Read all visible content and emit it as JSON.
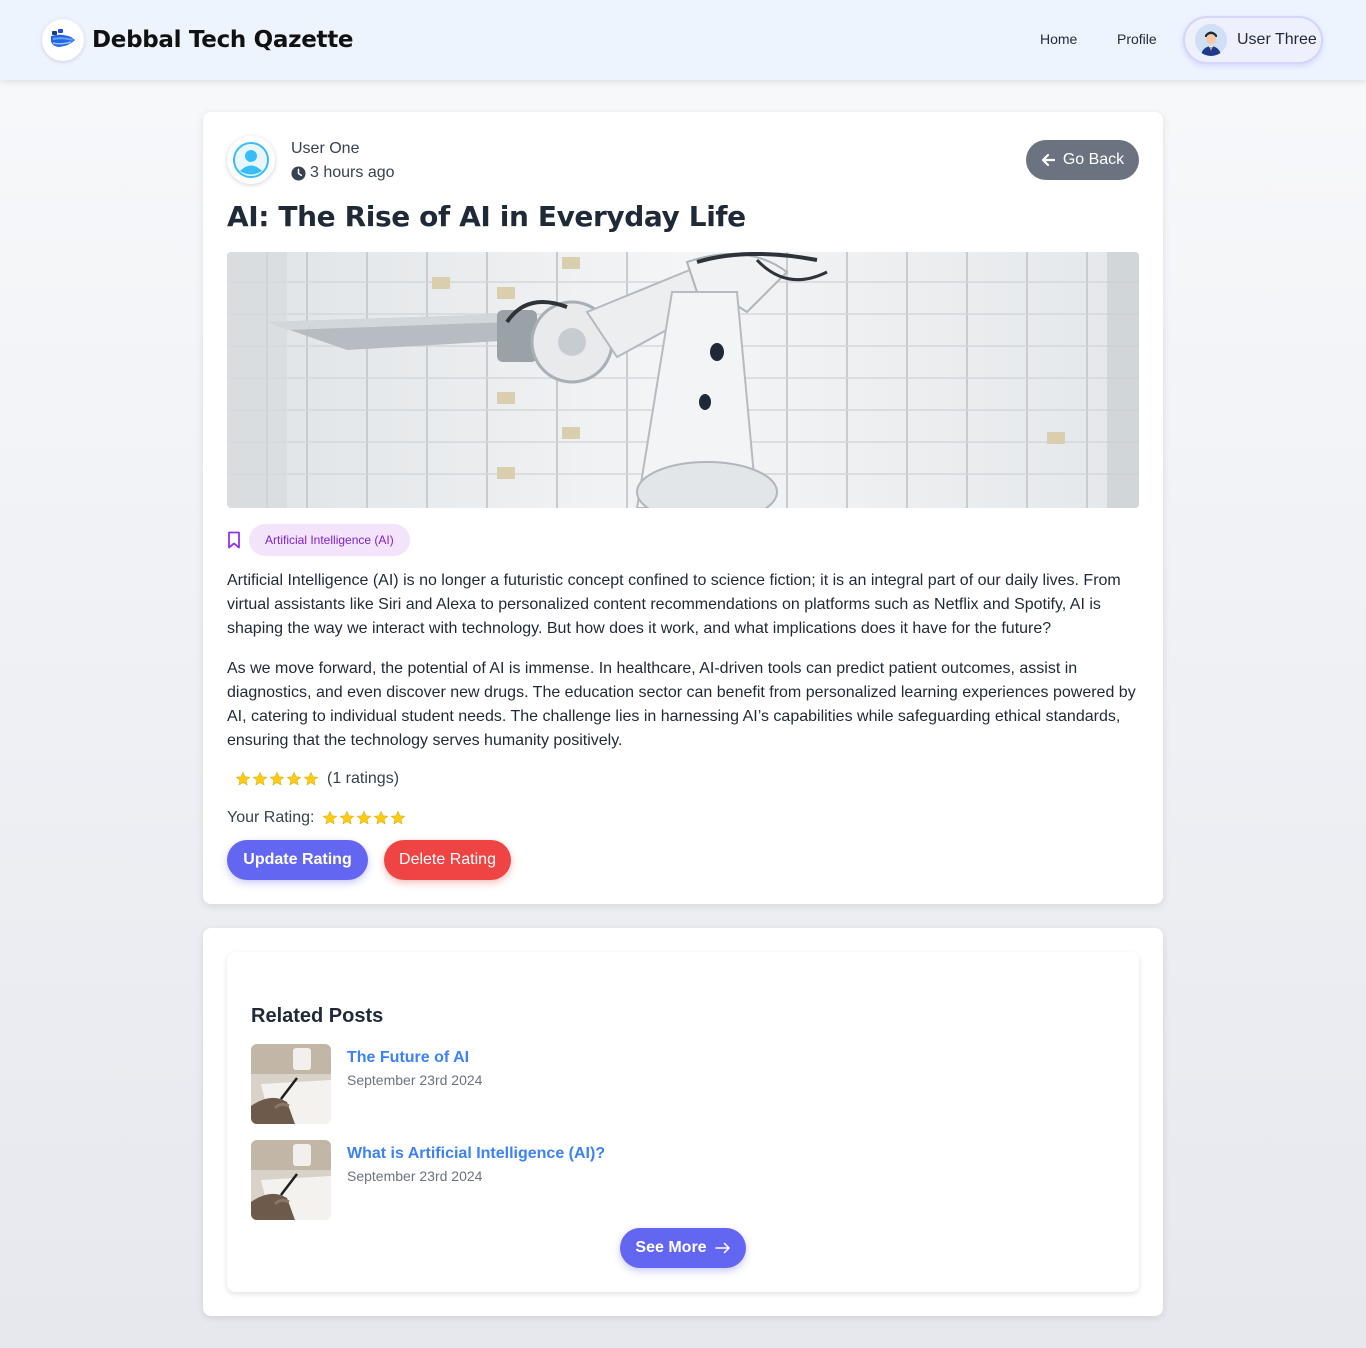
{
  "navbar": {
    "brand_name": "Debbal Tech Qazette",
    "links": [
      {
        "label": "Home"
      },
      {
        "label": "Profile"
      }
    ],
    "user_name": "User Three"
  },
  "post": {
    "author_name": "User One",
    "time_ago": "3 hours ago",
    "go_back_label": "Go Back",
    "title": "AI: The Rise of AI in Everyday Life",
    "category_tag": "Artificial Intelligence (AI)",
    "paragraphs": [
      "Artificial Intelligence (AI) is no longer a futuristic concept confined to science fiction; it is an integral part of our daily lives. From virtual assistants like Siri and Alexa to personalized content recommendations on platforms such as Netflix and Spotify, AI is shaping the way we interact with technology. But how does it work, and what implications does it have for the future?",
      "As we move forward, the potential of AI is immense. In healthcare, AI-driven tools can predict patient outcomes, assist in diagnostics, and even discover new drugs. The education sector can benefit from personalized learning experiences powered by AI, catering to individual student needs. The challenge lies in harnessing AI’s capabilities while safeguarding ethical standards, ensuring that the technology serves humanity positively."
    ],
    "average_rating_stars": 5,
    "rating_count_text": "(1 ratings)",
    "your_rating_label": "Your Rating:",
    "your_rating_stars": 5,
    "update_rating_label": "Update Rating",
    "delete_rating_label": "Delete Rating"
  },
  "related": {
    "title": "Related Posts",
    "items": [
      {
        "title": "The Future of AI",
        "date": "September 23rd 2024"
      },
      {
        "title": "What is Artificial Intelligence (AI)?",
        "date": "September 23rd 2024"
      }
    ],
    "see_more_label": "See More"
  },
  "colors": {
    "accent": "#6366f1",
    "danger": "#ef4444",
    "neutral_button": "#6b7280",
    "link": "#3b82f6",
    "star": "#facc15",
    "tag_bg": "#f3e3fb",
    "tag_text": "#7e22ce"
  },
  "icons": {
    "brand": "brand-logo-icon",
    "clock": "clock-icon",
    "go_back": "arrow-left-icon",
    "bookmark": "bookmark-icon",
    "star": "star-icon",
    "see_more": "arrow-right-icon"
  }
}
